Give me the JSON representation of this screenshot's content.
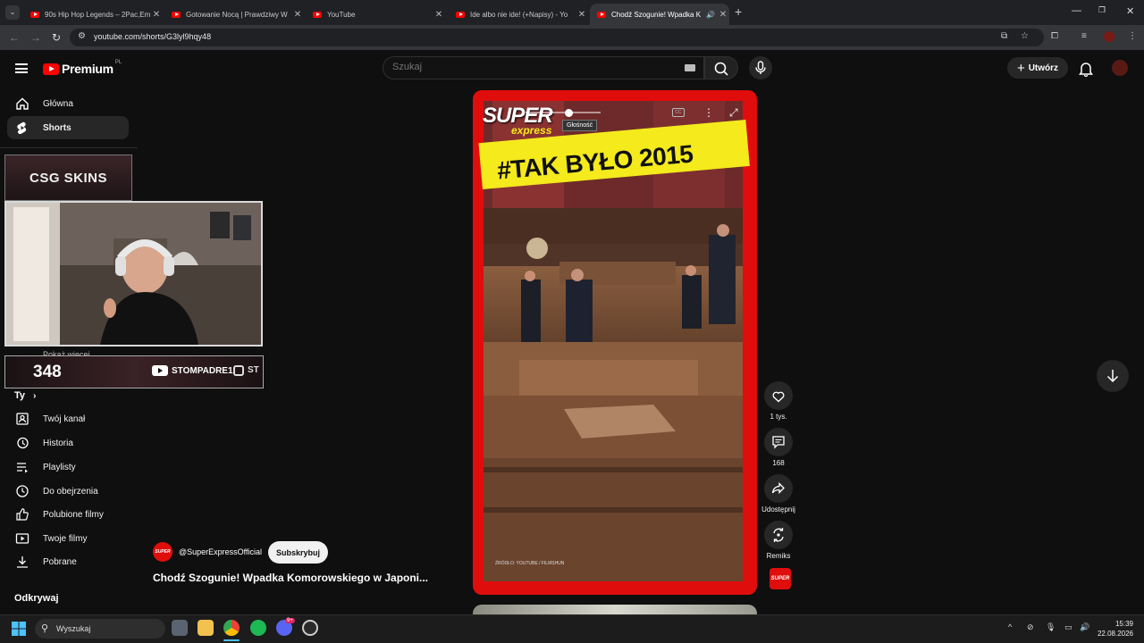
{
  "browser": {
    "tabs": [
      {
        "title": "90s Hip Hop Legends – 2Pac,Em",
        "active": false
      },
      {
        "title": "Gotowanie Nocą | Prawdziwy W",
        "active": false
      },
      {
        "title": "YouTube",
        "active": false
      },
      {
        "title": "Ide albo nie ide! (+Napisy) - Yo",
        "active": false
      },
      {
        "title": "Chodź Szogunie! Wpadka K",
        "active": true
      }
    ],
    "url": "youtube.com/shorts/G3lyl9hqy48"
  },
  "header": {
    "logo_text": "Premium",
    "logo_region": "PL",
    "search_placeholder": "Szukaj",
    "create_label": "Utwórz"
  },
  "sidebar": {
    "items": [
      {
        "label": "Główna",
        "icon": "home-icon",
        "selected": false
      },
      {
        "label": "Shorts",
        "icon": "shorts-icon",
        "selected": true
      }
    ],
    "you_section": {
      "heading": "Ty",
      "items": [
        {
          "label": "Twój kanał",
          "icon": "channel-icon"
        },
        {
          "label": "Historia",
          "icon": "history-icon"
        },
        {
          "label": "Playlisty",
          "icon": "playlist-icon"
        },
        {
          "label": "Do obejrzenia",
          "icon": "watch-later-icon"
        },
        {
          "label": "Polubione filmy",
          "icon": "like-icon"
        },
        {
          "label": "Twoje filmy",
          "icon": "video-icon"
        },
        {
          "label": "Pobrane",
          "icon": "download-icon"
        }
      ]
    },
    "explore_heading": "Odkrywaj",
    "partial_text": "Pokaż więcej"
  },
  "overlay": {
    "sponsor": "CSG SKINS",
    "viewer_count": "348",
    "social_handle": "STOMPADRE1",
    "social_handle_2": "ST"
  },
  "short": {
    "brand_super": "SUPER",
    "brand_express": "express",
    "banner_text": "#TAK BYŁO",
    "banner_year": "2015",
    "tooltip": "Głośność",
    "source_credit": "ŹRÓDŁO: YOUTUBE / FILMSHUN",
    "actions": [
      {
        "label": "1 tys.",
        "icon": "like-icon"
      },
      {
        "label": "168",
        "icon": "comment-icon"
      },
      {
        "label": "Udostępnij",
        "icon": "share-icon"
      },
      {
        "label": "Remiks",
        "icon": "remix-icon"
      }
    ],
    "channel_avatar_text": "SUPER",
    "channel_name": "@SuperExpressOfficial",
    "subscribe_label": "Subskrybuj",
    "title": "Chodź Szogunie! Wpadka Komorowskiego w Japoni..."
  },
  "taskbar": {
    "search_label": "Wyszukaj",
    "time": "15:39",
    "date": "22.08.2026",
    "discord_badge": "9+"
  },
  "colors": {
    "youtube_red": "#ff0000",
    "short_frame": "#e00d0d",
    "banner_yellow": "#f4ea1c"
  }
}
